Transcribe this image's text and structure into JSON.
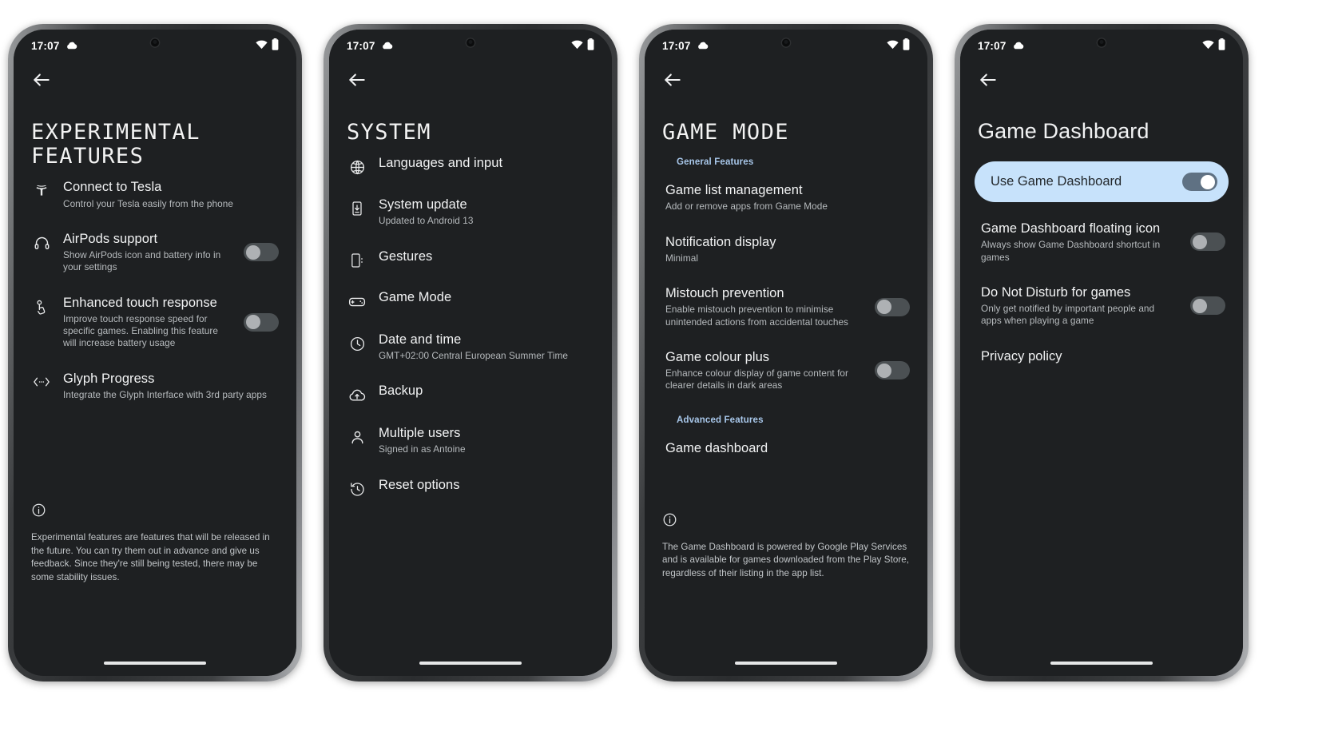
{
  "colors": {
    "screen_bg": "#1e2022",
    "accent_section": "#a8c7ea",
    "pill_bg": "#c7e2fb",
    "toggle_off": "#4b5053",
    "toggle_on": "#5f7183"
  },
  "status_bar": {
    "time": "17:07",
    "left_icon": "cloud-icon",
    "wifi_icon": "wifi-icon",
    "battery_icon": "battery-icon"
  },
  "phones": [
    {
      "id": "experimental-features",
      "title": "EXPERIMENTAL\nFEATURES",
      "title_style": "dot-matrix",
      "back_icon": "back-arrow-icon",
      "rows": [
        {
          "icon": "tesla-icon",
          "title": "Connect to Tesla",
          "subtitle": "Control your Tesla easily from the phone",
          "toggle": null
        },
        {
          "icon": "headphones-icon",
          "title": "AirPods support",
          "subtitle": "Show AirPods icon and battery info in your settings",
          "toggle": "off"
        },
        {
          "icon": "touch-icon",
          "title": "Enhanced touch response",
          "subtitle": "Improve touch response speed for specific games. Enabling this feature will increase battery usage",
          "toggle": "off"
        },
        {
          "icon": "glyph-icon",
          "title": "Glyph Progress",
          "subtitle": "Integrate the Glyph Interface with 3rd party apps",
          "toggle": null
        }
      ],
      "footer": {
        "icon": "info-icon",
        "text": "Experimental features are features that will be released in the future. You can try them out in advance and give us feedback. Since they're still being tested, there may be some stability issues."
      }
    },
    {
      "id": "system",
      "title": "SYSTEM",
      "title_style": "dot-matrix",
      "back_icon": "back-arrow-icon",
      "rows": [
        {
          "icon": "globe-icon",
          "title": "Languages and input",
          "subtitle": "",
          "toggle": null
        },
        {
          "icon": "system-update-icon",
          "title": "System update",
          "subtitle": "Updated to Android 13",
          "toggle": null
        },
        {
          "icon": "gestures-icon",
          "title": "Gestures",
          "subtitle": "",
          "toggle": null
        },
        {
          "icon": "gamepad-icon",
          "title": "Game Mode",
          "subtitle": "",
          "toggle": null
        },
        {
          "icon": "clock-icon",
          "title": "Date and time",
          "subtitle": "GMT+02:00 Central European Summer Time",
          "toggle": null
        },
        {
          "icon": "cloud-upload-icon",
          "title": "Backup",
          "subtitle": "",
          "toggle": null
        },
        {
          "icon": "person-icon",
          "title": "Multiple users",
          "subtitle": "Signed in as Antoine",
          "toggle": null
        },
        {
          "icon": "history-icon",
          "title": "Reset options",
          "subtitle": "",
          "toggle": null
        }
      ],
      "footer": null
    },
    {
      "id": "game-mode",
      "title": "GAME MODE",
      "title_style": "dot-matrix",
      "back_icon": "back-arrow-icon",
      "sections": [
        {
          "label": "General Features",
          "rows": [
            {
              "icon": null,
              "title": "Game list management",
              "subtitle": "Add or remove apps from Game Mode",
              "toggle": null
            },
            {
              "icon": null,
              "title": "Notification display",
              "subtitle": "Minimal",
              "toggle": null
            },
            {
              "icon": null,
              "title": "Mistouch prevention",
              "subtitle": "Enable mistouch prevention to minimise unintended actions from accidental touches",
              "toggle": "off"
            },
            {
              "icon": null,
              "title": "Game colour plus",
              "subtitle": "Enhance colour display of game content for clearer details in dark areas",
              "toggle": "off"
            }
          ]
        },
        {
          "label": "Advanced Features",
          "rows": [
            {
              "icon": null,
              "title": "Game dashboard",
              "subtitle": "",
              "toggle": null
            }
          ]
        }
      ],
      "footer": {
        "icon": "info-icon",
        "text": "The Game Dashboard is powered by Google Play Services and is available for games downloaded from the Play Store, regardless of their listing in the app list."
      }
    },
    {
      "id": "game-dashboard",
      "title": "Game Dashboard",
      "title_style": "plain",
      "back_icon": "back-arrow-icon",
      "pill": {
        "label": "Use Game Dashboard",
        "toggle": "on"
      },
      "rows": [
        {
          "icon": null,
          "title": "Game Dashboard floating icon",
          "subtitle": "Always show Game Dashboard shortcut in games",
          "toggle": "off"
        },
        {
          "icon": null,
          "title": "Do Not Disturb for games",
          "subtitle": "Only get notified by important people and apps when playing a game",
          "toggle": "off"
        },
        {
          "icon": null,
          "title": "Privacy policy",
          "subtitle": "",
          "toggle": null
        }
      ],
      "footer": null
    }
  ]
}
